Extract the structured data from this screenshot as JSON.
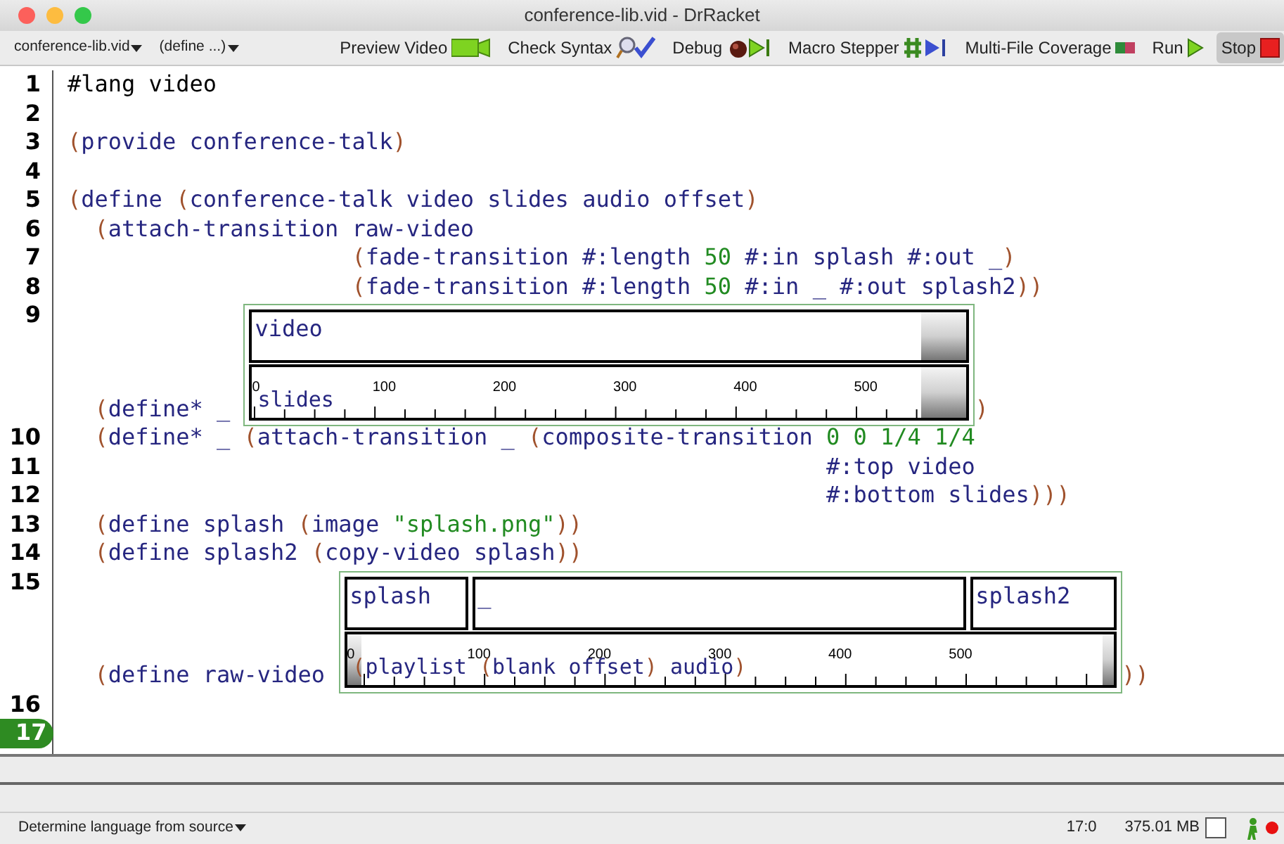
{
  "window": {
    "title": "conference-lib.vid - DrRacket"
  },
  "toolbar": {
    "menus": [
      {
        "label": "conference-lib.vid"
      },
      {
        "label": "(define ...)"
      }
    ],
    "buttons": [
      {
        "label": "Preview Video",
        "kind": "preview",
        "pressed": false
      },
      {
        "label": "Check Syntax",
        "kind": "check",
        "pressed": false
      },
      {
        "label": "Debug",
        "kind": "debug",
        "pressed": false
      },
      {
        "label": "Macro Stepper",
        "kind": "stepper",
        "pressed": false
      },
      {
        "label": "Multi-File Coverage",
        "kind": "coverage",
        "pressed": false
      },
      {
        "label": "Run",
        "kind": "run",
        "pressed": false
      },
      {
        "label": "Stop",
        "kind": "stop",
        "pressed": true
      }
    ]
  },
  "editor": {
    "lines": [
      {
        "number": "1",
        "current": false,
        "segments": [
          {
            "kind": "code",
            "tokens": [
              {
                "kind": "plain",
                "text": "#lang video"
              }
            ]
          }
        ]
      },
      {
        "number": "2",
        "current": false
      },
      {
        "number": "3",
        "current": false,
        "segments": [
          {
            "kind": "code",
            "tokens": [
              {
                "kind": "paren",
                "text": "("
              },
              {
                "kind": "id",
                "text": "provide conference-talk"
              },
              {
                "kind": "paren",
                "text": ")"
              }
            ]
          }
        ]
      },
      {
        "number": "4",
        "current": false
      },
      {
        "number": "5",
        "current": false,
        "segments": [
          {
            "kind": "code",
            "tokens": [
              {
                "kind": "paren",
                "text": "("
              },
              {
                "kind": "id",
                "text": "define "
              },
              {
                "kind": "paren",
                "text": "("
              },
              {
                "kind": "id",
                "text": "conference-talk video slides audio offset"
              },
              {
                "kind": "paren",
                "text": ")"
              }
            ]
          }
        ]
      },
      {
        "number": "6",
        "current": false,
        "segments": [
          {
            "kind": "code",
            "tokens": [
              {
                "kind": "paren",
                "text": "  ("
              },
              {
                "kind": "id",
                "text": "attach-transition raw-video"
              }
            ]
          }
        ]
      },
      {
        "number": "7",
        "current": false,
        "segments": [
          {
            "kind": "code",
            "tokens": [
              {
                "kind": "paren",
                "text": "                     ("
              },
              {
                "kind": "id",
                "text": "fade-transition #:length "
              },
              {
                "kind": "num",
                "text": "50"
              },
              {
                "kind": "id",
                "text": " #:in splash #:out _"
              },
              {
                "kind": "paren",
                "text": ")"
              }
            ]
          }
        ]
      },
      {
        "number": "8",
        "current": false,
        "segments": [
          {
            "kind": "code",
            "tokens": [
              {
                "kind": "paren",
                "text": "                     ("
              },
              {
                "kind": "id",
                "text": "fade-transition #:length "
              },
              {
                "kind": "num",
                "text": "50"
              },
              {
                "kind": "id",
                "text": " #:in _ #:out splash2"
              },
              {
                "kind": "paren",
                "text": "))"
              }
            ]
          }
        ]
      },
      {
        "number": "9",
        "current": false,
        "segments": [
          {
            "kind": "code",
            "tokens": [
              {
                "kind": "paren",
                "text": "  ("
              },
              {
                "kind": "id",
                "text": "define* _ "
              }
            ]
          },
          {
            "kind": "timeline",
            "rows": [
              {
                "clips": [
                  {
                    "tokens": [
                      {
                        "kind": "id",
                        "text": "video"
                      }
                    ]
                  }
                ]
              },
              {
                "clips": [
                  {
                    "tokens": [
                      {
                        "kind": "id",
                        "text": "slides"
                      }
                    ]
                  }
                ],
                "ruler": {
                  "labels": [
                    "0",
                    "100",
                    "200",
                    "300",
                    "400",
                    "500"
                  ]
                }
              }
            ]
          },
          {
            "kind": "code",
            "tokens": [
              {
                "kind": "paren",
                "text": ")"
              }
            ]
          }
        ]
      },
      {
        "number": "10",
        "current": false,
        "segments": [
          {
            "kind": "code",
            "tokens": [
              {
                "kind": "paren",
                "text": "  ("
              },
              {
                "kind": "id",
                "text": "define* _ "
              },
              {
                "kind": "paren",
                "text": "("
              },
              {
                "kind": "id",
                "text": "attach-transition _ "
              },
              {
                "kind": "paren",
                "text": "("
              },
              {
                "kind": "id",
                "text": "composite-transition "
              },
              {
                "kind": "num",
                "text": "0 0 1/4 1/4"
              }
            ]
          }
        ]
      },
      {
        "number": "11",
        "current": false,
        "segments": [
          {
            "kind": "code",
            "tokens": [
              {
                "kind": "id",
                "text": "                                                        #:top video"
              }
            ]
          }
        ]
      },
      {
        "number": "12",
        "current": false,
        "segments": [
          {
            "kind": "code",
            "tokens": [
              {
                "kind": "id",
                "text": "                                                        #:bottom slides"
              },
              {
                "kind": "paren",
                "text": ")))"
              }
            ]
          }
        ]
      },
      {
        "number": "13",
        "current": false,
        "segments": [
          {
            "kind": "code",
            "tokens": [
              {
                "kind": "paren",
                "text": "  ("
              },
              {
                "kind": "id",
                "text": "define splash "
              },
              {
                "kind": "paren",
                "text": "("
              },
              {
                "kind": "id",
                "text": "image "
              },
              {
                "kind": "str",
                "text": "\"splash.png\""
              },
              {
                "kind": "paren",
                "text": "))"
              }
            ]
          }
        ]
      },
      {
        "number": "14",
        "current": false,
        "segments": [
          {
            "kind": "code",
            "tokens": [
              {
                "kind": "paren",
                "text": "  ("
              },
              {
                "kind": "id",
                "text": "define splash2 "
              },
              {
                "kind": "paren",
                "text": "("
              },
              {
                "kind": "id",
                "text": "copy-video splash"
              },
              {
                "kind": "paren",
                "text": "))"
              }
            ]
          }
        ]
      },
      {
        "number": "15",
        "current": false,
        "segments": [
          {
            "kind": "code",
            "tokens": [
              {
                "kind": "paren",
                "text": "  ("
              },
              {
                "kind": "id",
                "text": "define raw-video "
              }
            ]
          },
          {
            "kind": "timeline",
            "rows": [
              {
                "clips": [
                  {
                    "tokens": [
                      {
                        "kind": "id",
                        "text": "splash"
                      }
                    ]
                  },
                  {
                    "tokens": [
                      {
                        "kind": "id",
                        "text": "_"
                      }
                    ]
                  },
                  {
                    "tokens": [
                      {
                        "kind": "id",
                        "text": "splash2"
                      }
                    ]
                  }
                ]
              },
              {
                "clips": [
                  {
                    "tokens": [
                      {
                        "kind": "paren",
                        "text": "("
                      },
                      {
                        "kind": "id",
                        "text": "playlist "
                      },
                      {
                        "kind": "paren",
                        "text": "("
                      },
                      {
                        "kind": "id",
                        "text": "blank offset"
                      },
                      {
                        "kind": "paren",
                        "text": ")"
                      },
                      {
                        "kind": "id",
                        "text": " audio"
                      },
                      {
                        "kind": "paren",
                        "text": ")"
                      }
                    ]
                  }
                ],
                "ruler": {
                  "labels": [
                    "0",
                    "100",
                    "200",
                    "300",
                    "400",
                    "500"
                  ]
                }
              }
            ]
          },
          {
            "kind": "code",
            "tokens": [
              {
                "kind": "paren",
                "text": "))"
              }
            ]
          }
        ]
      },
      {
        "number": "16",
        "current": false
      },
      {
        "number": "17",
        "current": true
      }
    ]
  },
  "status_bar": {
    "language": "Determine language from source",
    "position": "17:0",
    "memory": "375.01 MB"
  }
}
